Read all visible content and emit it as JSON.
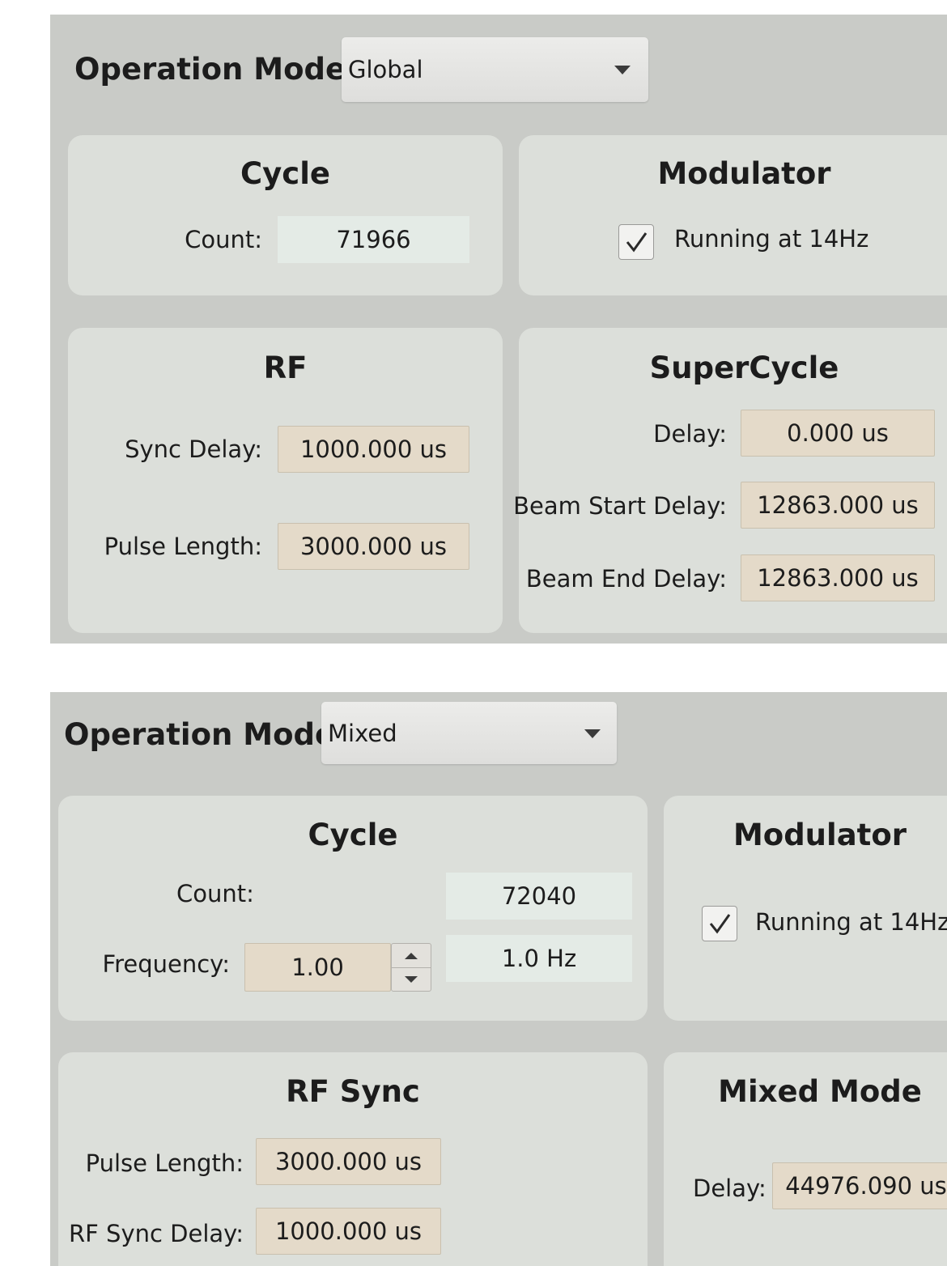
{
  "global_panel": {
    "operation_mode_label": "Operation Mode:",
    "operation_mode_value": "Global",
    "cycle": {
      "title": "Cycle",
      "count_label": "Count:",
      "count_value": "71966"
    },
    "modulator": {
      "title": "Modulator",
      "running_checked": true,
      "running_label": "Running at 14Hz"
    },
    "rf": {
      "title": "RF",
      "sync_delay_label": "Sync Delay:",
      "sync_delay_value": "1000.000 us",
      "pulse_length_label": "Pulse Length:",
      "pulse_length_value": "3000.000 us"
    },
    "supercycle": {
      "title": "SuperCycle",
      "delay_label": "Delay:",
      "delay_value": "0.000 us",
      "beam_start_label": "Beam Start Delay:",
      "beam_start_value": "12863.000 us",
      "beam_end_label": "Beam End Delay:",
      "beam_end_value": "12863.000 us"
    }
  },
  "mixed_panel": {
    "operation_mode_label": "Operation Mode:",
    "operation_mode_value": "Mixed",
    "cycle": {
      "title": "Cycle",
      "count_label": "Count:",
      "count_value": "72040",
      "frequency_label": "Frequency:",
      "frequency_input": "1.00",
      "frequency_readout": "1.0 Hz"
    },
    "modulator": {
      "title": "Modulator",
      "running_checked": true,
      "running_label": "Running at 14Hz"
    },
    "rf_sync": {
      "title": "RF Sync",
      "pulse_length_label": "Pulse Length:",
      "pulse_length_value": "3000.000 us",
      "rf_sync_delay_label": "RF Sync Delay:",
      "rf_sync_delay_value": "1000.000 us"
    },
    "mixed_mode": {
      "title": "Mixed Mode",
      "delay_label": "Delay:",
      "delay_value": "44976.090 us"
    }
  },
  "icons": {
    "dropdown": "chevron-down-icon",
    "check": "checkmark-icon",
    "spin_up": "arrow-up-icon",
    "spin_down": "arrow-down-icon"
  },
  "colors": {
    "panel_bg": "#c9cbc7",
    "card_bg": "#dcdfda",
    "readonly_field": "#e4ebe6",
    "editable_field": "#e4dac9"
  }
}
